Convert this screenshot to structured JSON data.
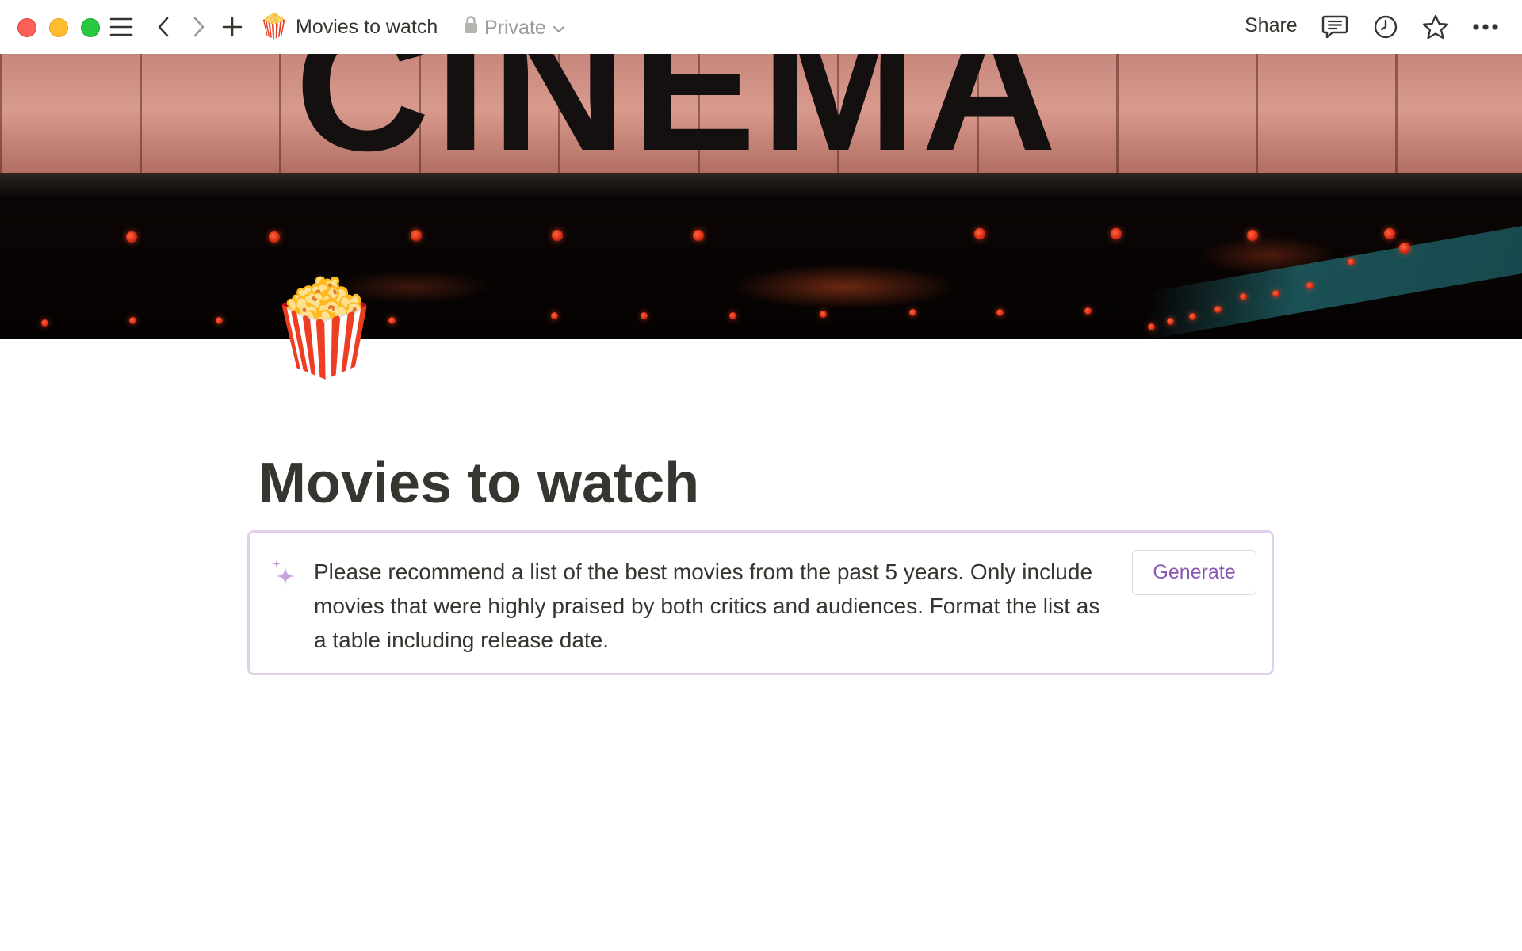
{
  "window": {
    "traffic_lights": [
      "close",
      "minimize",
      "zoom"
    ]
  },
  "topbar": {
    "breadcrumb_emoji": "🍿",
    "breadcrumb_title": "Movies to watch",
    "privacy_label": "Private",
    "share_label": "Share",
    "icons": [
      "sidebar-menu-icon",
      "back-arrow-icon",
      "forward-arrow-icon",
      "plus-icon",
      "lock-icon",
      "chevron-down-icon",
      "comment-icon",
      "clock-icon",
      "star-icon",
      "more-icon"
    ]
  },
  "cover": {
    "sign_text": "CINEMA"
  },
  "page": {
    "emoji": "🍿",
    "title": "Movies to watch"
  },
  "ai_block": {
    "icon": "sparkle-icon",
    "prompt": "Please recommend a list of the best movies from the past 5 years. Only include movies that were highly praised by both critics and audiences. Format the list as a table including release date.",
    "generate_label": "Generate"
  },
  "colors": {
    "text": "#37352f",
    "muted": "#9b9a97",
    "accent_purple": "#8b59b3",
    "block_border": "#e3cfe9",
    "close": "#fe5f57",
    "minimize": "#febc2e",
    "zoom": "#28c840"
  }
}
